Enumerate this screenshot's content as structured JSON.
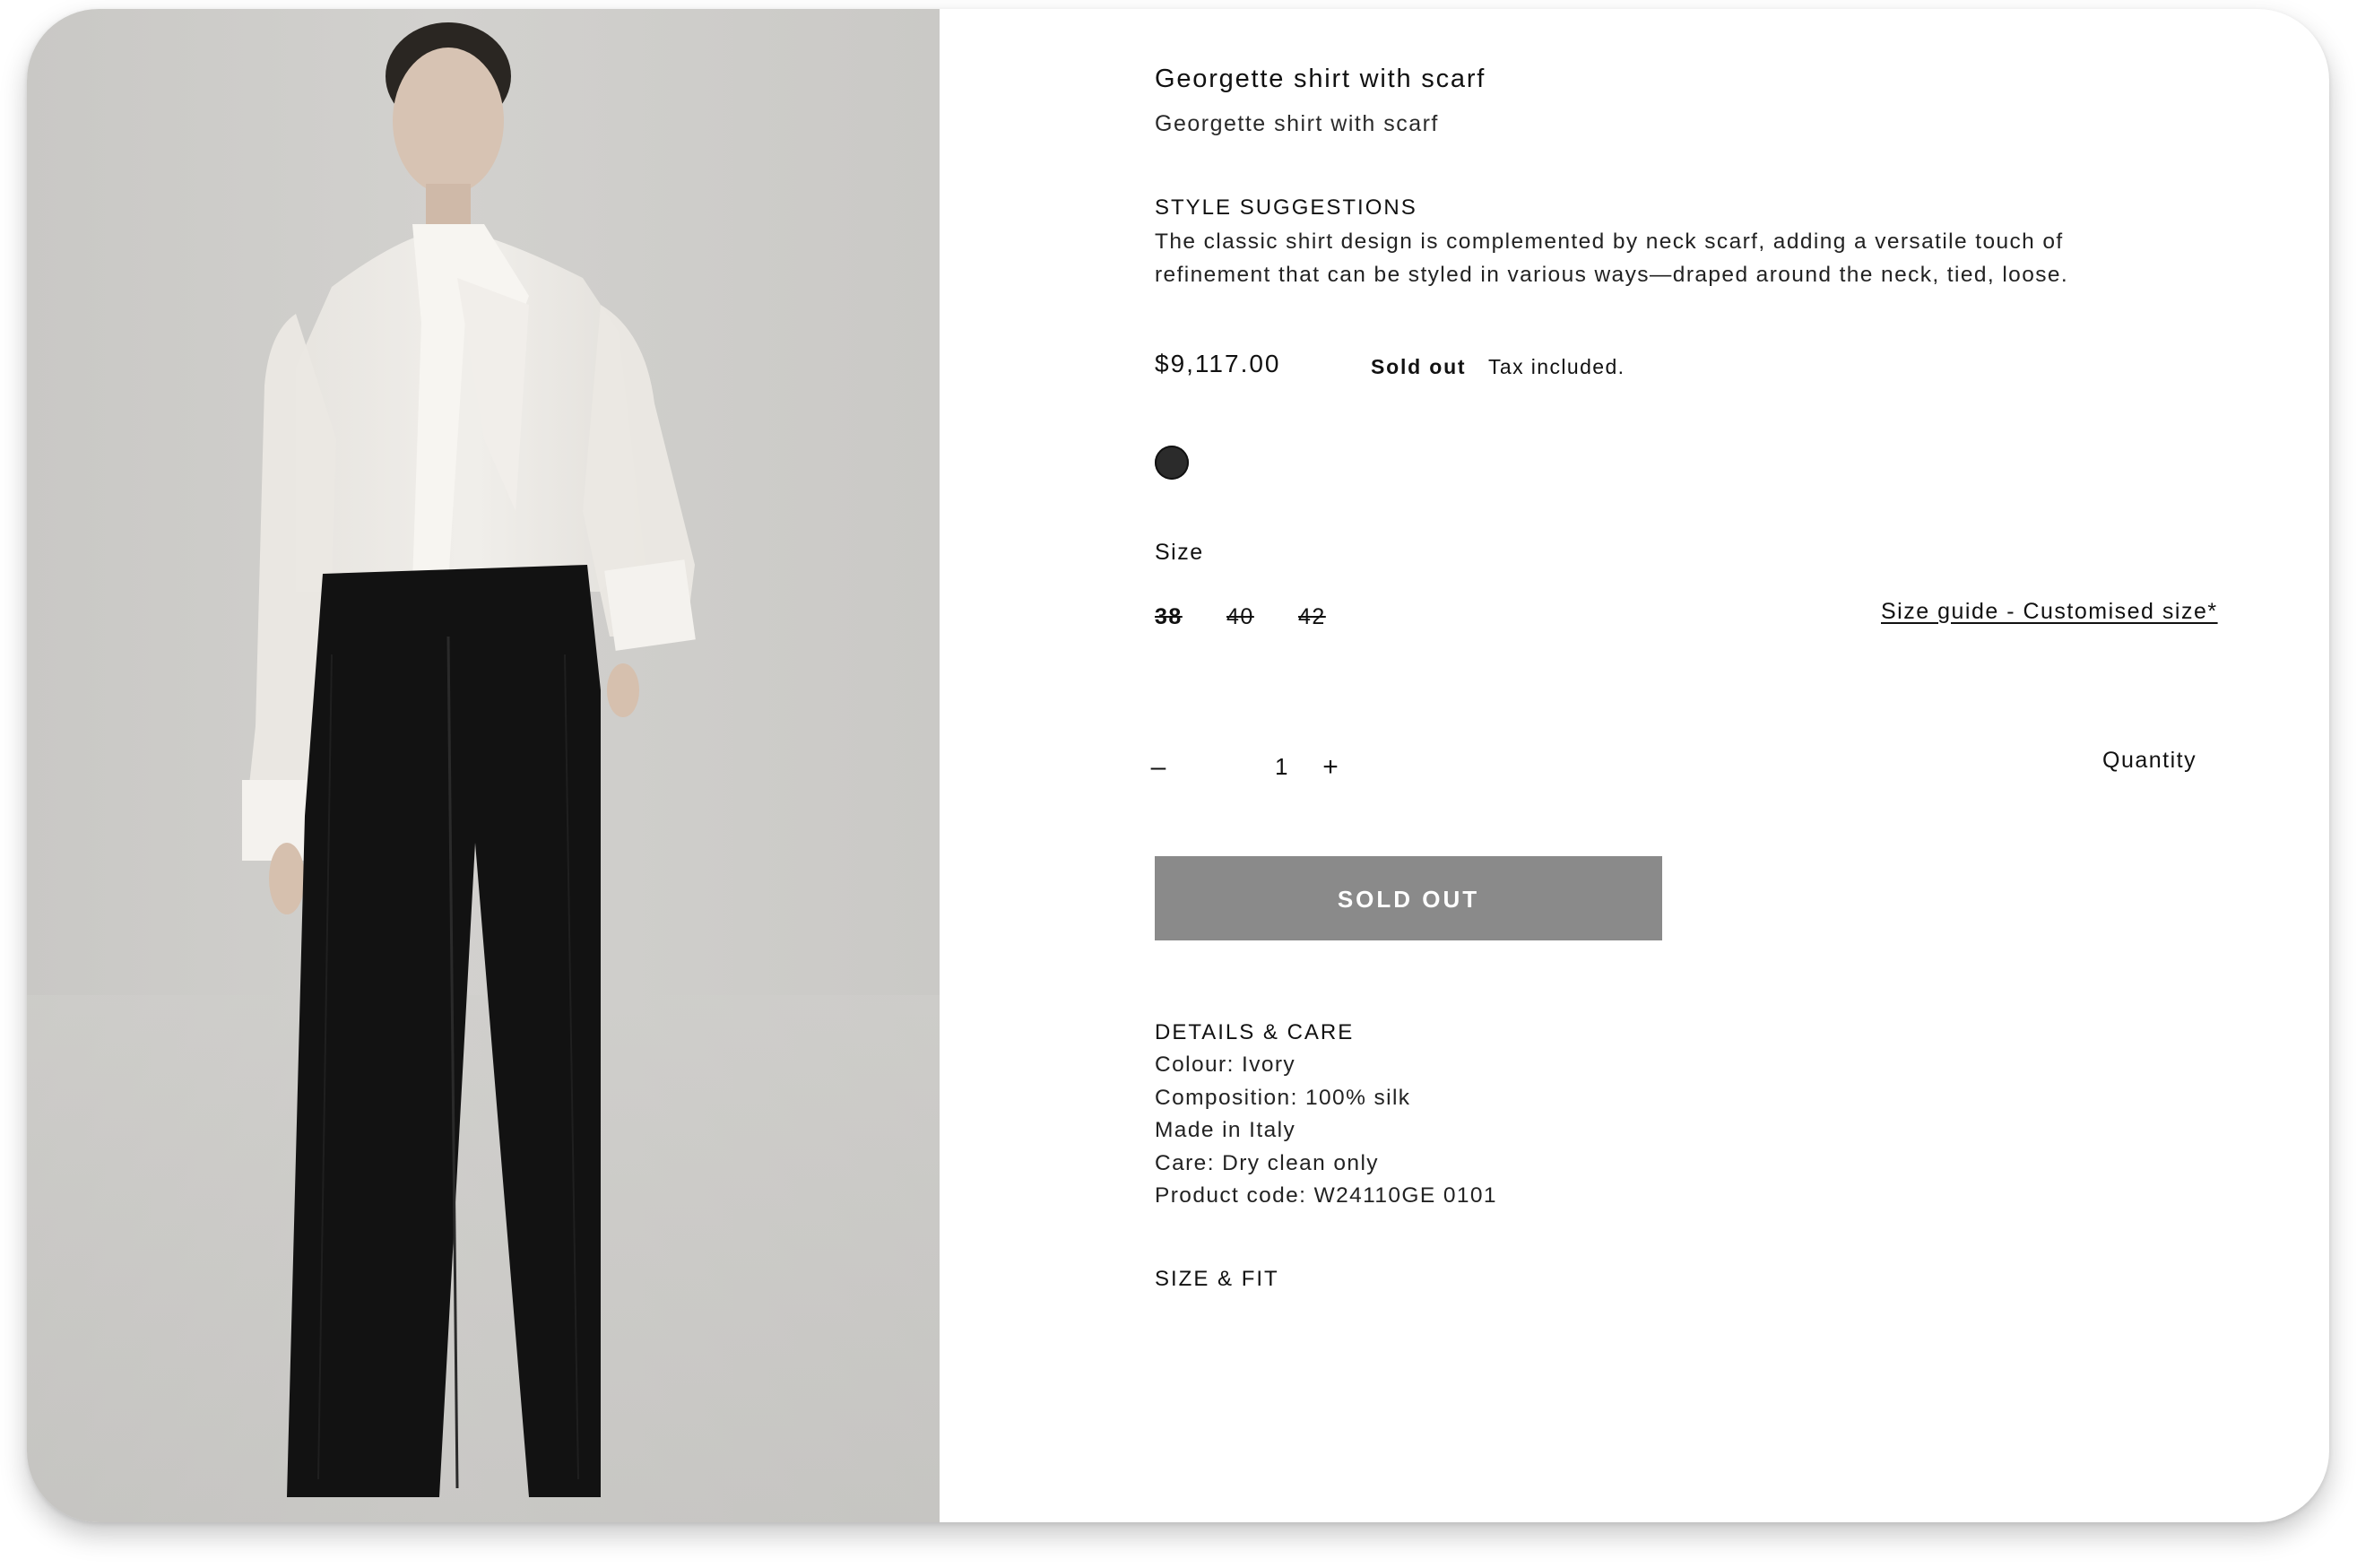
{
  "product": {
    "title": "Georgette shirt with scarf",
    "subtitle": "Georgette shirt with scarf",
    "image_alt": "model wearing ivory georgette shirt with neck scarf and black wide trousers"
  },
  "style_suggestions": {
    "heading": "STYLE SUGGESTIONS",
    "text": "The classic shirt design is complemented by neck scarf, adding a versatile touch of refinement that can be styled in various ways—draped around the neck, tied, loose."
  },
  "pricing": {
    "price": "$9,117.00",
    "status": "Sold out",
    "tax_note": "Tax included."
  },
  "colour": {
    "swatch_color": "#2b2b2b"
  },
  "size": {
    "label": "Size",
    "options": [
      "38",
      "40",
      "42"
    ],
    "guide_link": "Size guide - Customised size*"
  },
  "quantity": {
    "minus": "–",
    "value": "1",
    "plus": "+",
    "label": "Quantity"
  },
  "cta": {
    "sold_out_label": "SOLD OUT",
    "color": "#8a8a8a"
  },
  "details": {
    "heading": "DETAILS & CARE",
    "items": [
      "Colour: Ivory",
      "Composition: 100% silk",
      "Made in Italy",
      "Care: Dry clean only",
      "Product code: W24110GE 0101"
    ]
  },
  "size_fit": {
    "heading": "SIZE & FIT"
  }
}
